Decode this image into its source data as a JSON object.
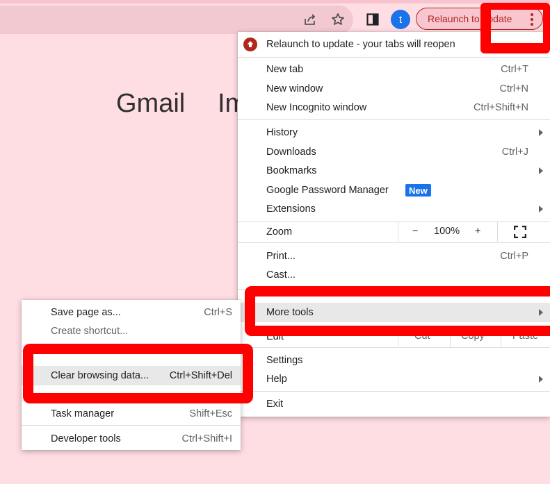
{
  "toolbar": {
    "relaunch_pill_label": "Relaunch to update",
    "avatar_initial": "t",
    "icons": [
      "share-icon",
      "star-icon",
      "side-panel-icon",
      "kebab-menu-icon"
    ]
  },
  "page": {
    "link_gmail": "Gmail",
    "link_images": "Images"
  },
  "main_menu": {
    "relaunch": "Relaunch to update - your tabs will reopen",
    "new_tab": {
      "label": "New tab",
      "shortcut": "Ctrl+T"
    },
    "new_window": {
      "label": "New window",
      "shortcut": "Ctrl+N"
    },
    "new_incognito": {
      "label": "New Incognito window",
      "shortcut": "Ctrl+Shift+N"
    },
    "history": {
      "label": "History"
    },
    "downloads": {
      "label": "Downloads",
      "shortcut": "Ctrl+J"
    },
    "bookmarks": {
      "label": "Bookmarks"
    },
    "password_manager": {
      "label": "Google Password Manager",
      "badge": "New"
    },
    "extensions": {
      "label": "Extensions"
    },
    "zoom": {
      "label": "Zoom",
      "minus": "−",
      "level": "100%",
      "plus": "+"
    },
    "print": {
      "label": "Print...",
      "shortcut": "Ctrl+P"
    },
    "cast": {
      "label": "Cast..."
    },
    "more_tools": {
      "label": "More tools"
    },
    "edit": {
      "label": "Edit",
      "cut": "Cut",
      "copy": "Copy",
      "paste": "Paste"
    },
    "settings": {
      "label": "Settings"
    },
    "help": {
      "label": "Help"
    },
    "exit": {
      "label": "Exit"
    }
  },
  "sub_menu": {
    "save_page": {
      "label": "Save page as...",
      "shortcut": "Ctrl+S"
    },
    "create_shortcut": {
      "label": "Create shortcut..."
    },
    "clear_browsing": {
      "label": "Clear browsing data...",
      "shortcut": "Ctrl+Shift+Del"
    },
    "task_manager": {
      "label": "Task manager",
      "shortcut": "Shift+Esc"
    },
    "developer_tools": {
      "label": "Developer tools",
      "shortcut": "Ctrl+Shift+I"
    }
  },
  "colors": {
    "page_bg": "#fedde3",
    "accent_red": "#b3261e",
    "annotation_red": "#ff0000",
    "badge_blue": "#1a73e8"
  }
}
